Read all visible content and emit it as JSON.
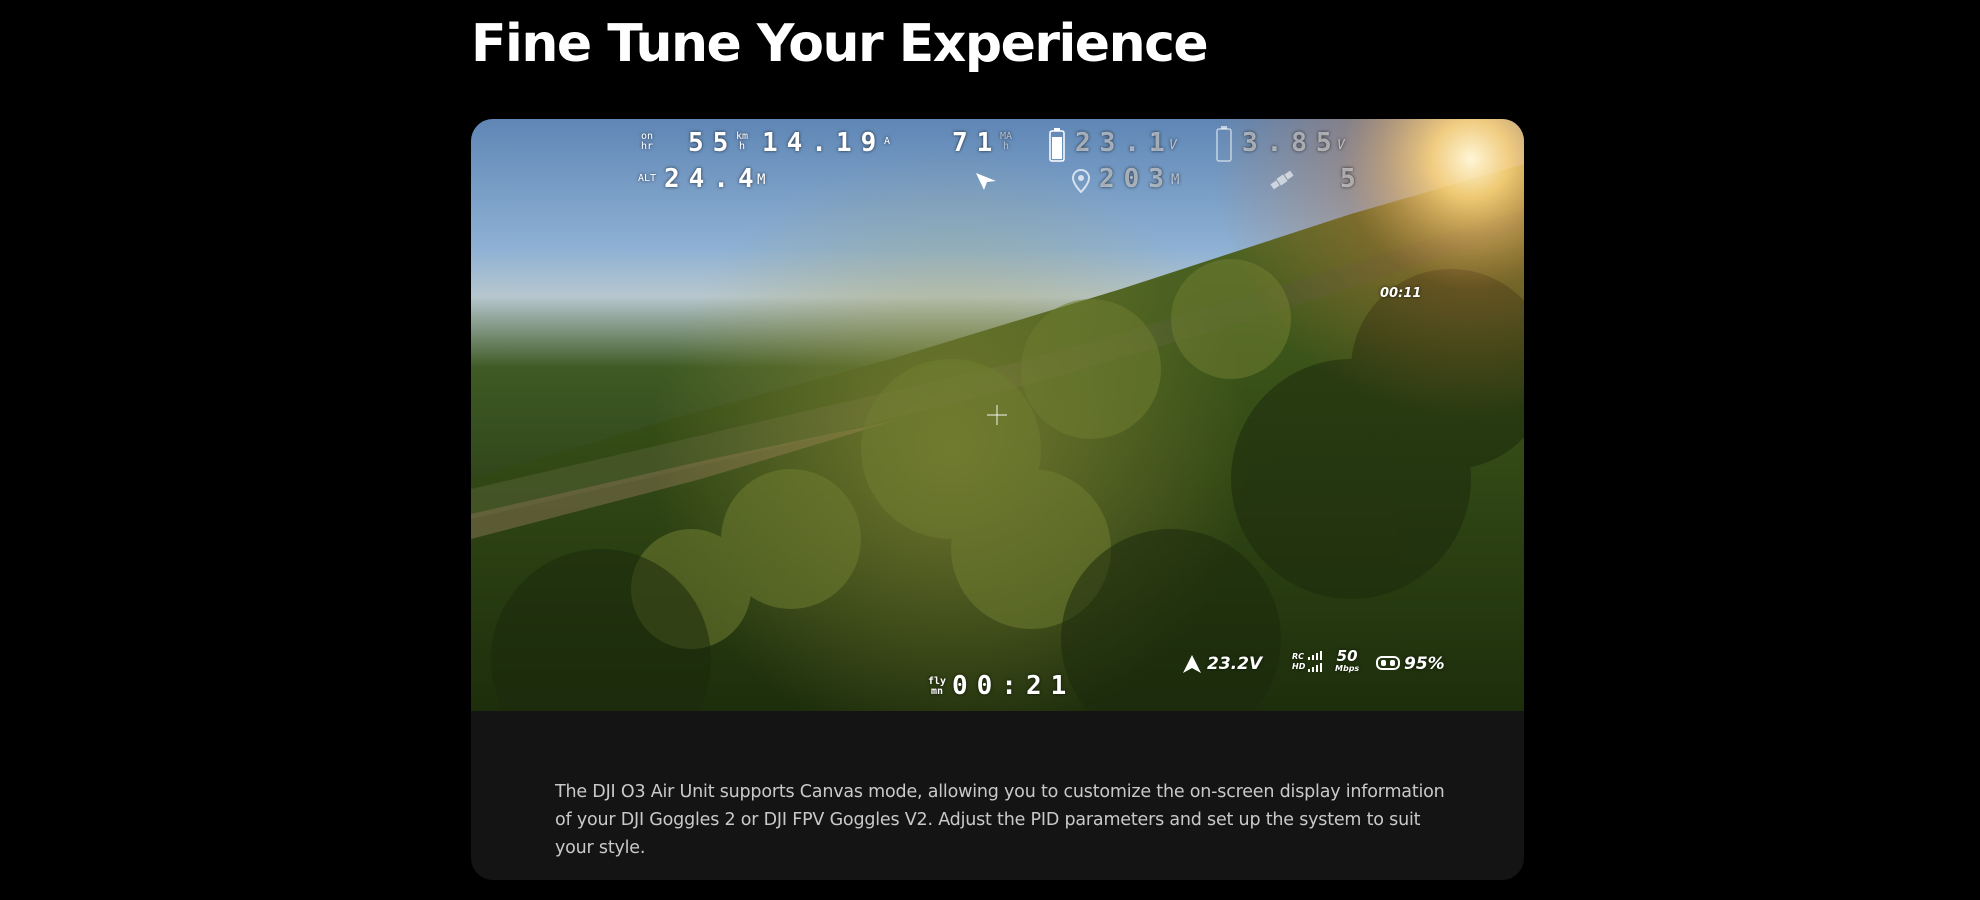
{
  "section": {
    "title": "Fine Tune Your Experience",
    "description": "The DJI O3 Air Unit supports Canvas mode, allowing you to customize the on-screen display information of your DJI Goggles 2 or DJI FPV Goggles V2. Adjust the PID parameters and set up the system to suit your style."
  },
  "osd": {
    "hr_label_top": "on",
    "hr_label_bottom": "hr",
    "speed_value": "55",
    "speed_unit_top": "km",
    "speed_unit_bottom": "h",
    "current_value": "14.19",
    "current_unit": "A",
    "capacity_value": "71",
    "capacity_unit_top": "MA",
    "capacity_unit_bottom": "h",
    "battery_voltage": "23.1",
    "battery_voltage_unit": "V",
    "cell_voltage": "3.85",
    "cell_voltage_unit": "V",
    "alt_label": "ALT",
    "altitude_value": "24.4",
    "altitude_unit": "M",
    "distance_value": "203",
    "distance_unit": "M",
    "satellites": "5",
    "record_time": "00:11",
    "fly_label_top": "fly",
    "fly_label_bottom": "mn",
    "fly_time": "00:21",
    "drone_voltage": "23.2V",
    "rc_label": "RC",
    "hd_label": "HD",
    "bitrate_value": "50",
    "bitrate_unit": "Mbps",
    "goggles_battery": "95%"
  },
  "icons": [
    "battery-icon",
    "cell-battery-icon",
    "arrow-icon",
    "home-distance-icon",
    "satellite-icon",
    "crosshair-icon",
    "drone-arrow-icon",
    "signal-bars-icon",
    "goggles-icon"
  ],
  "colors": {
    "background": "#000000",
    "card": "#141414",
    "caption": "#c9c9c9"
  }
}
